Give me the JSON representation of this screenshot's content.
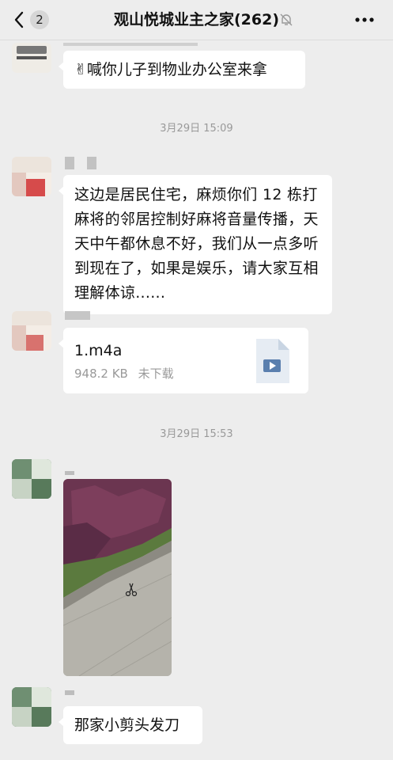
{
  "header": {
    "unread_count": "2",
    "title": "观山悦城业主之家(262)"
  },
  "messages": {
    "m1_text": "✌喊你儿子到物业办公室来拿",
    "t1": "3月29日 15:09",
    "m2_text": "这边是居民住宅，麻烦你们 12 栋打麻将的邻居控制好麻将音量传播，天天中午都休息不好，我们从一点多听到现在了，如果是娱乐，请大家互相理解体谅......",
    "file": {
      "name": "1.m4a",
      "size": "948.2 KB",
      "status": "未下载"
    },
    "t2": "3月29日 15:53",
    "m5_text": "那家小剪头发刀"
  },
  "colors": {
    "background": "#ededed",
    "bubble": "#ffffff",
    "timestamp": "#999999"
  },
  "icons": [
    "back-chevron-icon",
    "mute-bell-icon",
    "more-icon",
    "audio-file-icon"
  ]
}
